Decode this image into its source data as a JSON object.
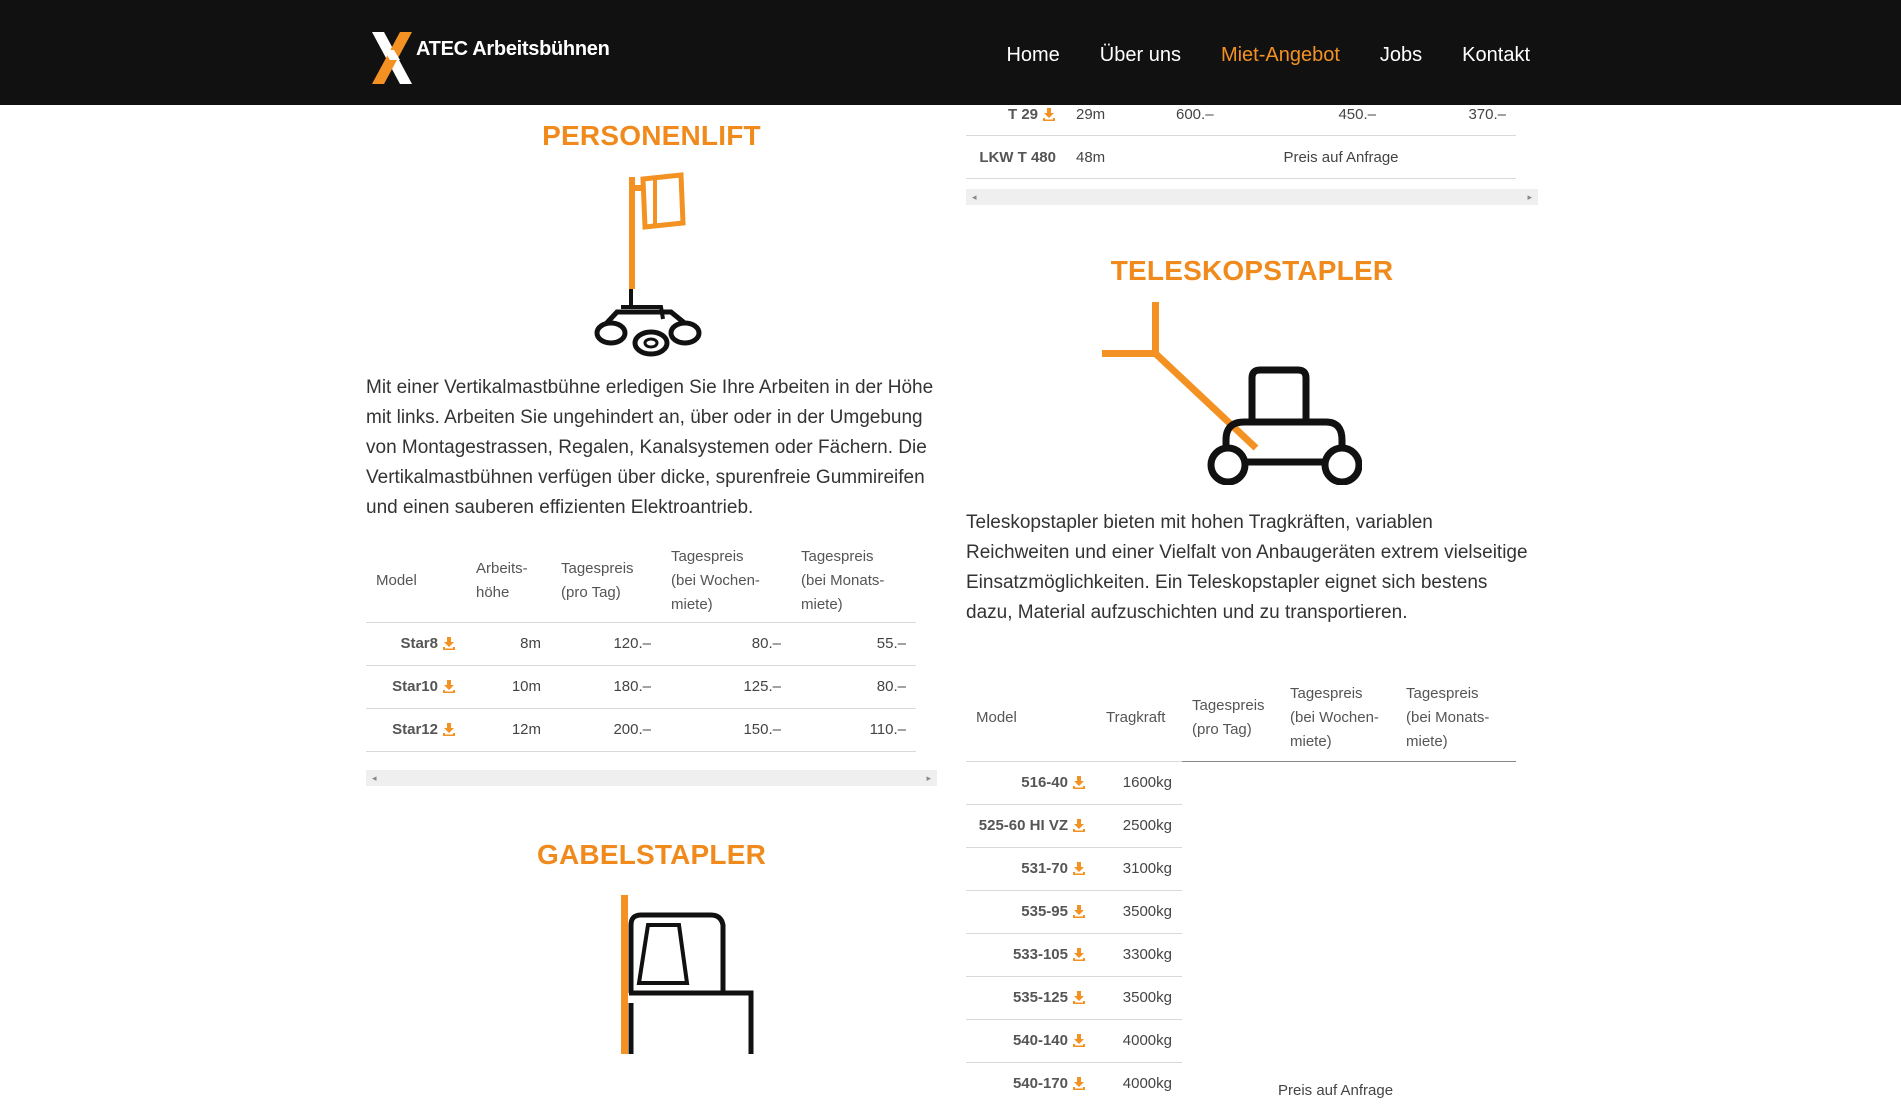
{
  "header": {
    "logo_text": "ATEC Arbeitsbühnen",
    "nav": [
      {
        "label": "Home",
        "active": false
      },
      {
        "label": "Über uns",
        "active": false
      },
      {
        "label": "Miet-Angebot",
        "active": true
      },
      {
        "label": "Jobs",
        "active": false
      },
      {
        "label": "Kontakt",
        "active": false
      }
    ]
  },
  "colors": {
    "accent": "#f39223",
    "header_bg": "#111111",
    "text": "#333333"
  },
  "top_table_fragment": {
    "rows": [
      {
        "model": "T 29",
        "hoehe": "29m",
        "tag": "600.–",
        "woche": "450.–",
        "monat": "370.–"
      },
      {
        "model": "LKW T 480",
        "hoehe": "48m",
        "preis": "Preis auf Anfrage"
      }
    ]
  },
  "personenlift": {
    "title": "PERSONENLIFT",
    "text": "Mit einer Vertikalmastbühne erledigen Sie Ihre Arbeiten in der Höhe mit links. Arbeiten Sie ungehindert an, über oder in der Umgebung von Montagestrassen, Regalen, Kanalsystemen oder Fächern. Die Vertikalmastbühnen verfügen über dicke, spurenfreie Gummireifen und einen sauberen effizienten Elektroantrieb.",
    "headers": {
      "model": "Model",
      "hoehe_1": "Arbeits-",
      "hoehe_2": "höhe",
      "tag_1": "Tagespreis",
      "tag_2": "(pro Tag)",
      "woche_1": "Tagespreis",
      "woche_2": "(bei Wochen-",
      "woche_3": "miete)",
      "monat_1": "Tagespreis",
      "monat_2": "(bei Monats-",
      "monat_3": "miete)"
    },
    "rows": [
      {
        "model": "Star8",
        "hoehe": "8m",
        "tag": "120.–",
        "woche": "80.–",
        "monat": "55.–"
      },
      {
        "model": "Star10",
        "hoehe": "10m",
        "tag": "180.–",
        "woche": "125.–",
        "monat": "80.–"
      },
      {
        "model": "Star12",
        "hoehe": "12m",
        "tag": "200.–",
        "woche": "150.–",
        "monat": "110.–"
      }
    ]
  },
  "gabelstapler": {
    "title": "GABELSTAPLER"
  },
  "teleskopstapler": {
    "title": "TELESKOPSTAPLER",
    "text": "Teleskopstapler bieten mit hohen Tragkräften, variablen Reichweiten und einer Vielfalt von Anbaugeräten extrem vielseitige Einsatzmöglichkeiten. Ein Teleskopstapler eignet sich bestens dazu, Material aufzuschichten und zu transportieren.",
    "headers": {
      "model": "Model",
      "kraft": "Tragkraft",
      "tag_1": "Tagespreis",
      "tag_2": "(pro Tag)",
      "woche_1": "Tagespreis",
      "woche_2": "(bei Wochen-",
      "woche_3": "miete)",
      "monat_1": "Tagespreis",
      "monat_2": "(bei Monats-",
      "monat_3": "miete)"
    },
    "rows": [
      {
        "model": "516-40",
        "kraft": "1600kg"
      },
      {
        "model": "525-60 HI VZ",
        "kraft": "2500kg"
      },
      {
        "model": "531-70",
        "kraft": "3100kg"
      },
      {
        "model": "535-95",
        "kraft": "3500kg"
      },
      {
        "model": "533-105",
        "kraft": "3300kg"
      },
      {
        "model": "535-125",
        "kraft": "3500kg"
      },
      {
        "model": "540-140",
        "kraft": "4000kg"
      },
      {
        "model": "540-170",
        "kraft": "4000kg"
      }
    ],
    "price_note": "Preis auf Anfrage"
  }
}
